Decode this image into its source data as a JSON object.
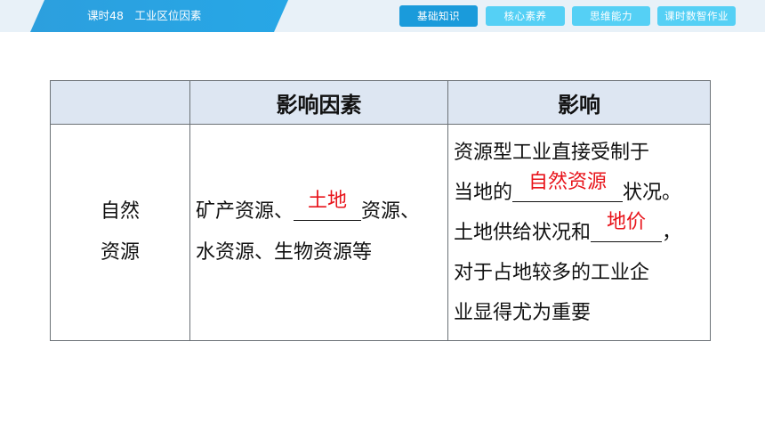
{
  "header": {
    "lesson_title": "课时48　工业区位因素",
    "tabs": [
      {
        "label": "基础知识",
        "active": true
      },
      {
        "label": "核心素养",
        "active": false
      },
      {
        "label": "思维能力",
        "active": false
      },
      {
        "label": "课时数智作业",
        "active": false
      }
    ]
  },
  "table": {
    "headers": [
      "",
      "影响因素",
      "影响"
    ],
    "row": {
      "factor_line1": "自然",
      "factor_line2": "资源",
      "list_part1": "矿产资源、",
      "list_blank_answer": "土地",
      "list_part2": "资源、",
      "list_part3": "水资源、生物资源等",
      "effect_line1": "资源型工业直接受制于",
      "effect_line2_prefix": "当地的",
      "effect_blank1_answer": "自然资源",
      "effect_line2_suffix": "状况。",
      "effect_line3_prefix": "土地供给状况和",
      "effect_blank2_answer": "地价",
      "effect_line3_suffix": "，",
      "effect_line4": "对于占地较多的工业企",
      "effect_line5": "业显得尤为重要"
    }
  },
  "colors": {
    "title_bar": "#2c9fde",
    "tab_active": "#1a9bdb",
    "tab_inactive": "#55d0f5",
    "answer_red": "#e8141b",
    "header_row_bg": "#dde6f2"
  }
}
